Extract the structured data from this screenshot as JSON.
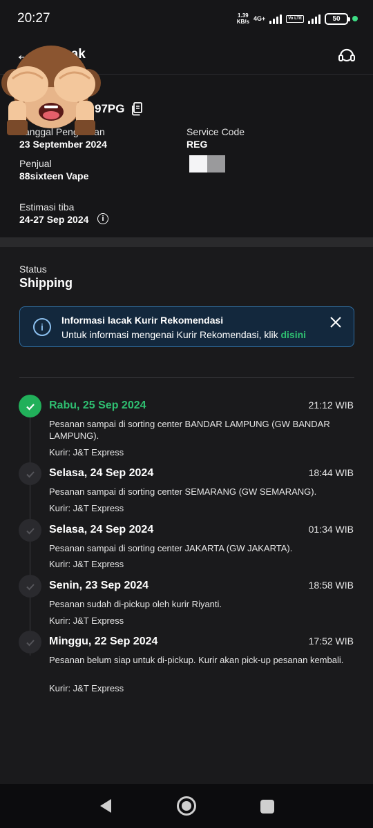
{
  "status_bar": {
    "time": "20:27",
    "speed_value": "1.39",
    "speed_unit": "KB/s",
    "network": "4G+",
    "volte": "Vo LTE",
    "battery": "50"
  },
  "header": {
    "title": "Lacak",
    "back_icon": "arrow-left-icon",
    "support_icon": "headset-icon"
  },
  "order": {
    "invoice": "97PG",
    "date_label": "Tanggal Pengiriman",
    "date_value": "23 September 2024",
    "service_label": "Service Code",
    "service_value": "REG",
    "seller_label": "Penjual",
    "seller_value": "88sixteen Vape",
    "eta_label": "Estimasi tiba",
    "eta_value": "24-27 Sep 2024"
  },
  "status": {
    "label": "Status",
    "value": "Shipping"
  },
  "banner": {
    "title": "Informasi lacak Kurir Rekomendasi",
    "text": "Untuk informasi mengenai Kurir Rekomendasi, klik ",
    "link": "disini"
  },
  "timeline": [
    {
      "date": "Rabu, 25 Sep 2024",
      "time": "21:12 WIB",
      "desc": "Pesanan sampai di sorting center BANDAR LAMPUNG (GW BANDAR LAMPUNG).",
      "courier": "Kurir: J&T Express",
      "active": true
    },
    {
      "date": "Selasa, 24 Sep 2024",
      "time": "18:44 WIB",
      "desc": "Pesanan sampai di sorting center SEMARANG (GW SEMARANG).",
      "courier": "Kurir: J&T Express",
      "active": false
    },
    {
      "date": "Selasa, 24 Sep 2024",
      "time": "01:34 WIB",
      "desc": "Pesanan sampai di sorting center JAKARTA (GW JAKARTA).",
      "courier": "Kurir: J&T Express",
      "active": false
    },
    {
      "date": "Senin, 23 Sep 2024",
      "time": "18:58 WIB",
      "desc": "Pesanan sudah di-pickup oleh kurir Riyanti.",
      "courier": "Kurir: J&T Express",
      "active": false
    },
    {
      "date": "Minggu, 22 Sep 2024",
      "time": "17:52 WIB",
      "desc": "Pesanan belum siap untuk di-pickup. Kurir akan pick-up pesanan kembali.",
      "courier": "Kurir: J&T Express",
      "active": false
    }
  ],
  "colors": {
    "accent": "#2fbf71",
    "background": "#1a1a1c",
    "banner_bg": "#13283d",
    "banner_border": "#2f6c9e"
  }
}
